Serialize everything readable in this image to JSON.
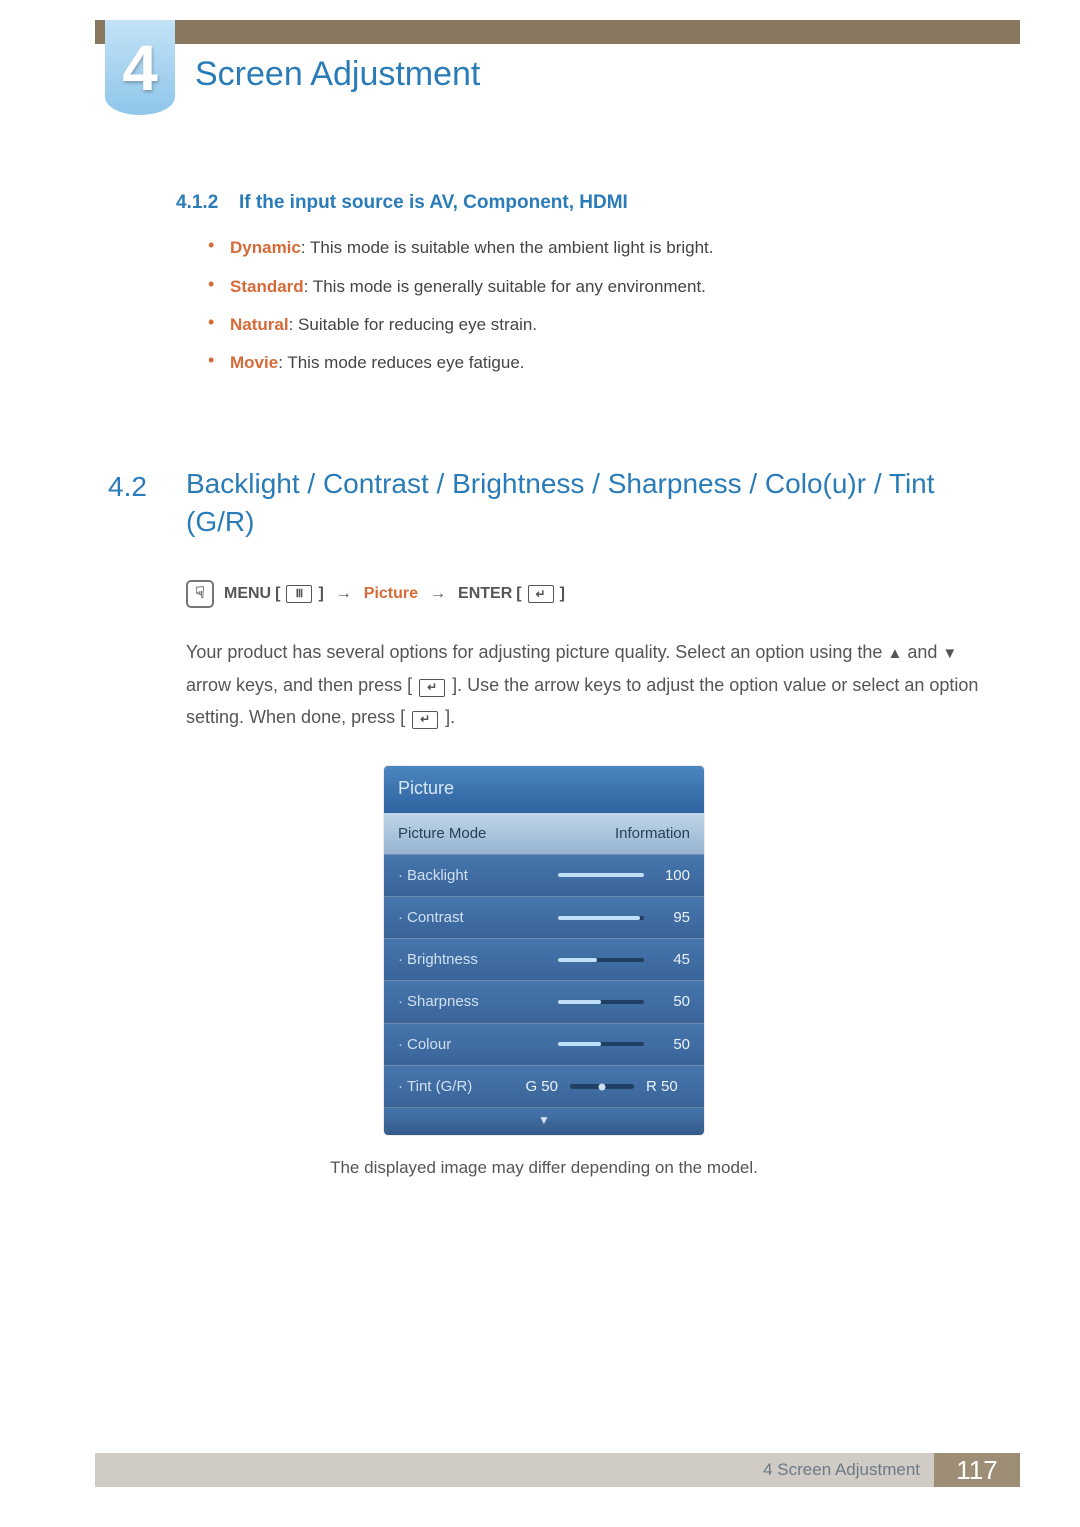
{
  "chapter": {
    "number": "4",
    "title": "Screen Adjustment"
  },
  "subsection": {
    "number": "4.1.2",
    "title": "If the input source is AV, Component, HDMI"
  },
  "modes": [
    {
      "name": "Dynamic",
      "desc": ": This mode is suitable when the ambient light is bright."
    },
    {
      "name": "Standard",
      "desc": ": This mode is generally suitable for any environment."
    },
    {
      "name": "Natural",
      "desc": ": Suitable for reducing eye strain."
    },
    {
      "name": "Movie",
      "desc": ": This mode reduces eye fatigue."
    }
  ],
  "major": {
    "number": "4.2",
    "title": "Backlight / Contrast / Brightness / Sharpness / Colo(u)r / Tint (G/R)"
  },
  "nav": {
    "menu": "MENU",
    "bracket_open": "[",
    "bracket_close": "]",
    "arrow": "→",
    "picture": "Picture",
    "enter": "ENTER"
  },
  "para_parts": {
    "a": "Your product has several options for adjusting picture quality. Select an option using the ",
    "up": "▲",
    "and": " and ",
    "down": "▼",
    "b": " arrow keys, and then press [",
    "c": "]. Use the arrow keys to adjust the option value or select an option setting. When done, press [",
    "d": "]."
  },
  "osd": {
    "title": "Picture",
    "head_left": "Picture Mode",
    "head_right": "Information",
    "rows": [
      {
        "label": "Backlight",
        "value": "100",
        "pct": 100
      },
      {
        "label": "Contrast",
        "value": "95",
        "pct": 95
      },
      {
        "label": "Brightness",
        "value": "45",
        "pct": 45
      },
      {
        "label": "Sharpness",
        "value": "50",
        "pct": 50
      },
      {
        "label": "Colour",
        "value": "50",
        "pct": 50
      }
    ],
    "tint": {
      "label": "Tint (G/R)",
      "g": "G 50",
      "r": "R 50"
    },
    "foot": "▼"
  },
  "note": "The displayed image may differ depending on the model.",
  "footer": {
    "label": "4 Screen Adjustment",
    "page": "117"
  }
}
